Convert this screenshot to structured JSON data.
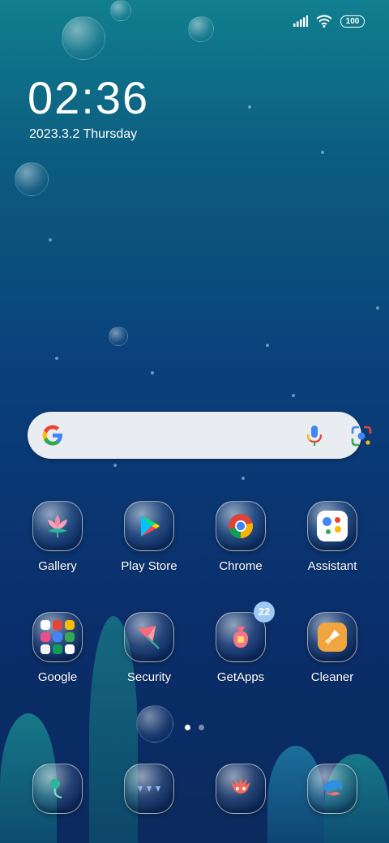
{
  "status_bar": {
    "battery": "100"
  },
  "lockscreen": {
    "time": "02:36",
    "date": "2023.3.2 Thursday"
  },
  "search": {},
  "apps_row1": [
    {
      "label": "Gallery"
    },
    {
      "label": "Play Store"
    },
    {
      "label": "Chrome"
    },
    {
      "label": "Assistant"
    }
  ],
  "apps_row2": [
    {
      "label": "Google"
    },
    {
      "label": "Security"
    },
    {
      "label": "GetApps",
      "badge": "22"
    },
    {
      "label": "Cleaner"
    }
  ],
  "dock": [
    {
      "icon": "flower-sprout-icon"
    },
    {
      "icon": "dots-icon"
    },
    {
      "icon": "dragon-icon"
    },
    {
      "icon": "dolphin-icon"
    }
  ],
  "colors": {
    "accent": "#9fc8f3",
    "search_bg": "#e9edf1"
  }
}
